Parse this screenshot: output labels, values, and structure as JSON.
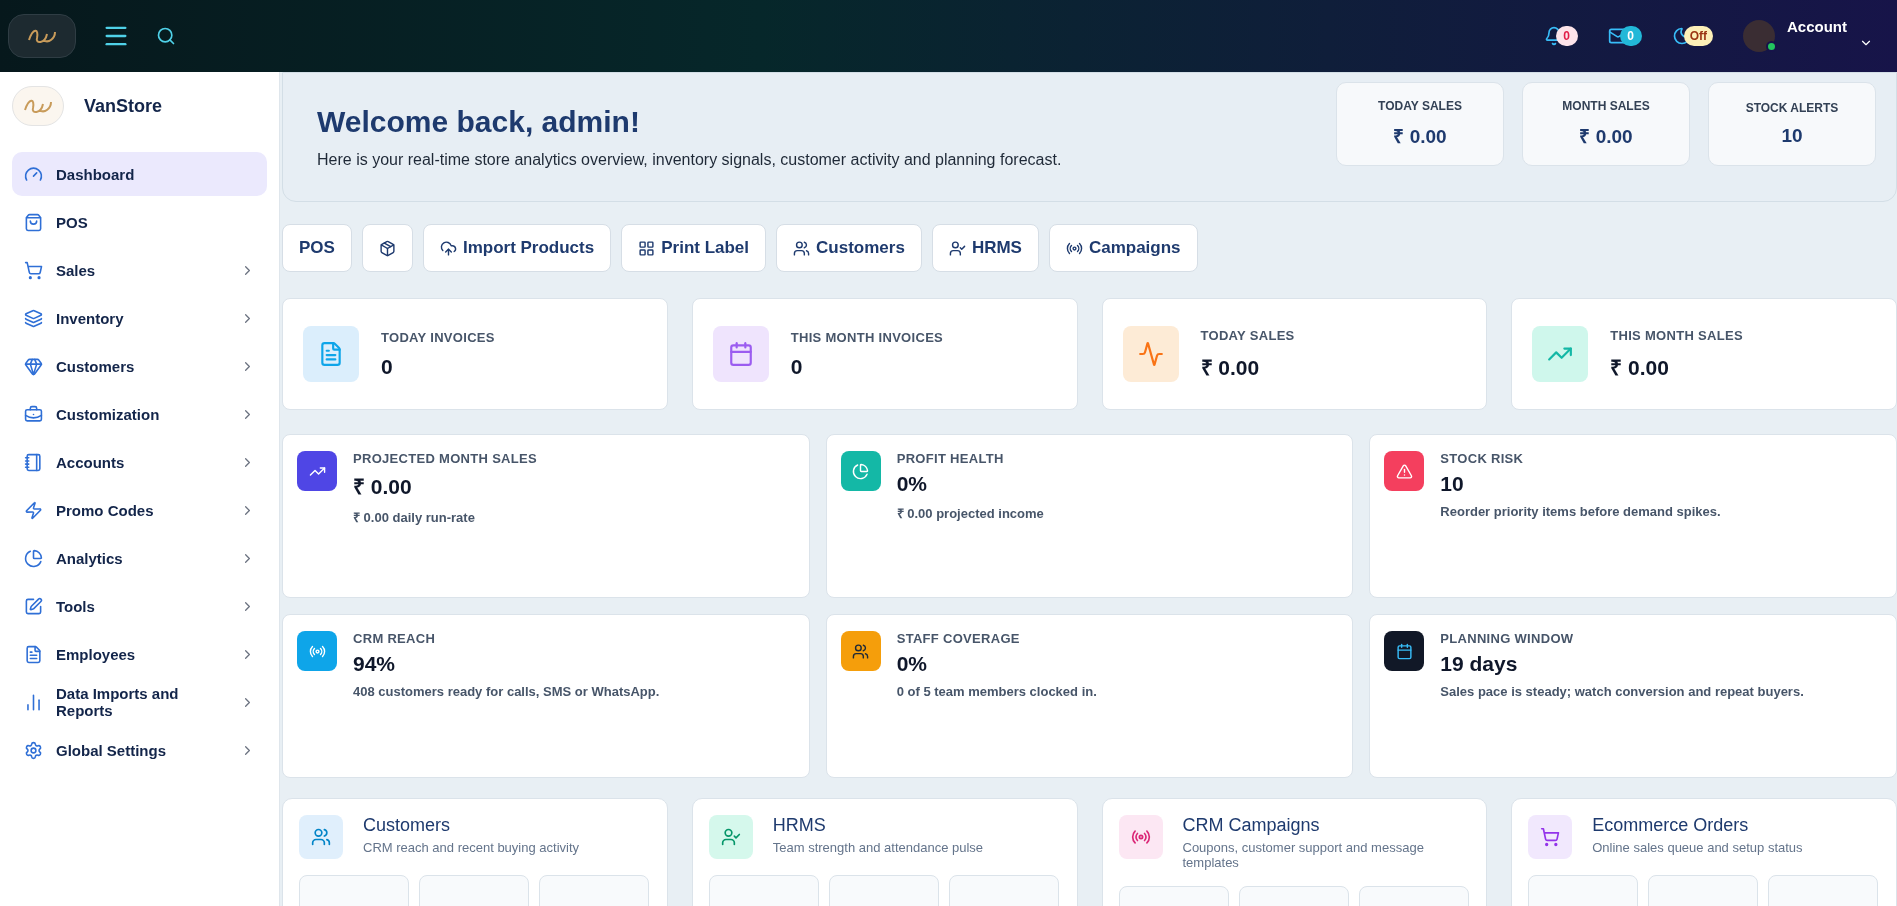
{
  "topbar": {
    "notifications": {
      "badge": "0"
    },
    "messages": {
      "badge": "0"
    },
    "theme": {
      "badge": "Off"
    },
    "account": {
      "label": "Account",
      "online": true
    }
  },
  "sidebar": {
    "brand": "VanStore",
    "items": [
      {
        "label": "Dashboard",
        "selected": true,
        "expandable": false
      },
      {
        "label": "POS",
        "selected": false,
        "expandable": false
      },
      {
        "label": "Sales",
        "selected": false,
        "expandable": true
      },
      {
        "label": "Inventory",
        "selected": false,
        "expandable": true
      },
      {
        "label": "Customers",
        "selected": false,
        "expandable": true
      },
      {
        "label": "Customization",
        "selected": false,
        "expandable": true
      },
      {
        "label": "Accounts",
        "selected": false,
        "expandable": true
      },
      {
        "label": "Promo Codes",
        "selected": false,
        "expandable": true
      },
      {
        "label": "Analytics",
        "selected": false,
        "expandable": true
      },
      {
        "label": "Tools",
        "selected": false,
        "expandable": true
      },
      {
        "label": "Employees",
        "selected": false,
        "expandable": true
      },
      {
        "label": "Data Imports and Reports",
        "selected": false,
        "expandable": true
      },
      {
        "label": "Global Settings",
        "selected": false,
        "expandable": true
      }
    ]
  },
  "welcome": {
    "title": "Welcome back, admin!",
    "subtitle": "Here is your real-time store analytics overview, inventory signals, customer activity and planning forecast.",
    "stats": [
      {
        "label": "TODAY SALES",
        "value": "₹ 0.00"
      },
      {
        "label": "MONTH SALES",
        "value": "₹ 0.00"
      },
      {
        "label": "STOCK ALERTS",
        "value": "10"
      }
    ]
  },
  "quick_actions": [
    {
      "kind": "text",
      "label": "POS"
    },
    {
      "kind": "icon"
    },
    {
      "kind": "icon_text",
      "label": "Import Products"
    },
    {
      "kind": "icon_text",
      "label": "Print Label"
    },
    {
      "kind": "icon_text",
      "label": "Customers"
    },
    {
      "kind": "icon_text",
      "label": "HRMS"
    },
    {
      "kind": "icon_text",
      "label": "Campaigns"
    }
  ],
  "stat_cards": [
    {
      "label": "TODAY INVOICES",
      "value": "0"
    },
    {
      "label": "THIS MONTH INVOICES",
      "value": "0"
    },
    {
      "label": "TODAY SALES",
      "value": "₹ 0.00"
    },
    {
      "label": "THIS MONTH SALES",
      "value": "₹ 0.00"
    }
  ],
  "insights": [
    {
      "label": "PROJECTED MONTH SALES",
      "value": "₹ 0.00",
      "note": "₹ 0.00 daily run-rate"
    },
    {
      "label": "PROFIT HEALTH",
      "value": "0%",
      "note": "₹ 0.00 projected income"
    },
    {
      "label": "STOCK RISK",
      "value": "10",
      "note": "Reorder priority items before demand spikes."
    },
    {
      "label": "CRM REACH",
      "value": "94%",
      "note": "408 customers ready for calls, SMS or WhatsApp."
    },
    {
      "label": "STAFF COVERAGE",
      "value": "0%",
      "note": "0 of 5 team members clocked in."
    },
    {
      "label": "PLANNING WINDOW",
      "value": "19 days",
      "note": "Sales pace is steady; watch conversion and repeat buyers."
    }
  ],
  "modules": [
    {
      "title": "Customers",
      "subtitle": "CRM reach and recent buying activity"
    },
    {
      "title": "HRMS",
      "subtitle": "Team strength and attendance pulse"
    },
    {
      "title": "CRM Campaigns",
      "subtitle": "Coupons, customer support and message templates"
    },
    {
      "title": "Ecommerce Orders",
      "subtitle": "Online sales queue and setup status"
    }
  ]
}
